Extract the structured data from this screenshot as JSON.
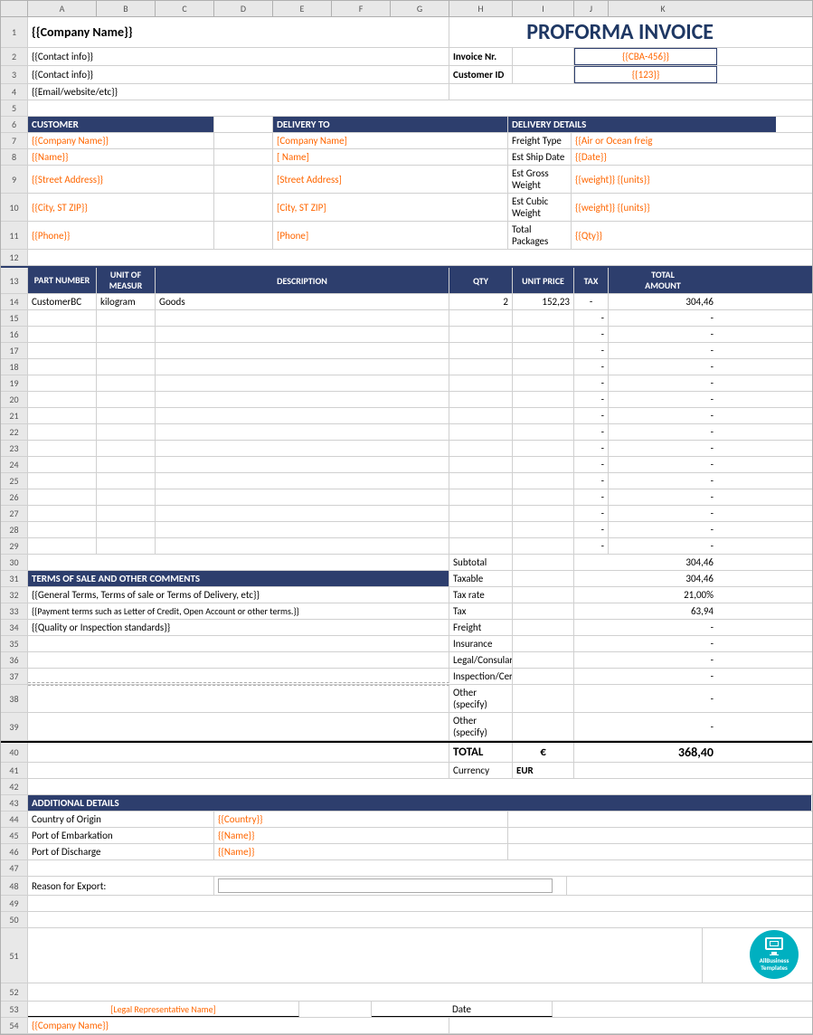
{
  "spreadsheet": {
    "col_headers": [
      "",
      "A",
      "B",
      "C",
      "D",
      "E",
      "F",
      "G",
      "H",
      "I",
      "J",
      "K"
    ],
    "company_name": "{{Company Name}}",
    "contact_info_1": "{{Contact info}}",
    "contact_info_2": "{{Contact info}}",
    "email_website": "{{Email/website/etc}}",
    "title": "PROFORMA INVOICE",
    "invoice_label": "Invoice Nr.",
    "invoice_value": "{{CBA-456}}",
    "customer_id_label": "Customer ID",
    "customer_id_value": "{{123}}",
    "customer_section": {
      "header": "CUSTOMER",
      "company": "{{Company Name}}",
      "name": "{{Name}}",
      "street": "{{Street Address}}",
      "city": "{{City, ST ZIP}}",
      "phone": "{{Phone}}"
    },
    "delivery_to_section": {
      "header": "DELIVERY TO",
      "company": "[Company Name]",
      "name": "[ Name]",
      "street": "[Street Address]",
      "city": "[City, ST  ZIP]",
      "phone": "[Phone]"
    },
    "delivery_details_section": {
      "header": "DELIVERY DETAILS",
      "freight_type_label": "Freight Type",
      "freight_type_value": "{{Air or Ocean freig",
      "ship_date_label": "Est Ship Date",
      "ship_date_value": "{{Date}}",
      "gross_weight_label": "Est Gross Weight",
      "gross_weight_value": "{{weight}} {{units}}",
      "cubic_weight_label": "Est Cubic Weight",
      "cubic_weight_value": "{{weight}} {{units}}",
      "packages_label": "Total Packages",
      "packages_value": "{{Qty}}"
    },
    "table": {
      "headers": [
        "PART NUMBER",
        "UNIT OF MEASUR",
        "DESCRIPTION",
        "QTY",
        "UNIT PRICE",
        "TAX",
        "TOTAL AMOUNT"
      ],
      "rows": [
        {
          "part": "CustomerBC",
          "unit": "kilogram",
          "desc": "Goods",
          "qty": "2",
          "price": "152,23",
          "tax": "-",
          "total": "304,46"
        },
        {
          "part": "",
          "unit": "",
          "desc": "",
          "qty": "",
          "price": "",
          "tax": "-",
          "total": "-"
        },
        {
          "part": "",
          "unit": "",
          "desc": "",
          "qty": "",
          "price": "",
          "tax": "-",
          "total": "-"
        },
        {
          "part": "",
          "unit": "",
          "desc": "",
          "qty": "",
          "price": "",
          "tax": "-",
          "total": "-"
        },
        {
          "part": "",
          "unit": "",
          "desc": "",
          "qty": "",
          "price": "",
          "tax": "-",
          "total": "-"
        },
        {
          "part": "",
          "unit": "",
          "desc": "",
          "qty": "",
          "price": "",
          "tax": "-",
          "total": "-"
        },
        {
          "part": "",
          "unit": "",
          "desc": "",
          "qty": "",
          "price": "",
          "tax": "-",
          "total": "-"
        },
        {
          "part": "",
          "unit": "",
          "desc": "",
          "qty": "",
          "price": "",
          "tax": "-",
          "total": "-"
        },
        {
          "part": "",
          "unit": "",
          "desc": "",
          "qty": "",
          "price": "",
          "tax": "-",
          "total": "-"
        },
        {
          "part": "",
          "unit": "",
          "desc": "",
          "qty": "",
          "price": "",
          "tax": "-",
          "total": "-"
        },
        {
          "part": "",
          "unit": "",
          "desc": "",
          "qty": "",
          "price": "",
          "tax": "-",
          "total": "-"
        },
        {
          "part": "",
          "unit": "",
          "desc": "",
          "qty": "",
          "price": "",
          "tax": "-",
          "total": "-"
        },
        {
          "part": "",
          "unit": "",
          "desc": "",
          "qty": "",
          "price": "",
          "tax": "-",
          "total": "-"
        },
        {
          "part": "",
          "unit": "",
          "desc": "",
          "qty": "",
          "price": "",
          "tax": "-",
          "total": "-"
        },
        {
          "part": "",
          "unit": "",
          "desc": "",
          "qty": "",
          "price": "",
          "tax": "-",
          "total": "-"
        },
        {
          "part": "",
          "unit": "",
          "desc": "",
          "qty": "",
          "price": "",
          "tax": "-",
          "total": "-"
        }
      ]
    },
    "terms_section": {
      "header": "TERMS OF SALE AND OTHER COMMENTS",
      "line1": "{{General Terms, Terms of sale or Terms of Delivery, etc}}",
      "line2": "{{Payment terms such as Letter of Credit, Open Account or other terms.}}",
      "line3": "{{Quality or Inspection standards}}"
    },
    "summary": {
      "subtotal_label": "Subtotal",
      "subtotal_value": "304,46",
      "taxable_label": "Taxable",
      "taxable_value": "304,46",
      "tax_rate_label": "Tax rate",
      "tax_rate_value": "21,00%",
      "tax_label": "Tax",
      "tax_value": "63,94",
      "freight_label": "Freight",
      "freight_value": "-",
      "insurance_label": "Insurance",
      "insurance_value": "-",
      "legal_label": "Legal/Consular",
      "legal_value": "-",
      "inspection_label": "Inspection/Cert.",
      "inspection_value": "-",
      "other1_label": "Other (specify)",
      "other1_value": "-",
      "other2_label": "Other (specify)",
      "other2_value": "-",
      "total_label": "TOTAL",
      "total_currency_symbol": "€",
      "total_value": "368,40",
      "currency_label": "Currency",
      "currency_value": "EUR"
    },
    "additional_details": {
      "header": "ADDITIONAL DETAILS",
      "country_label": "Country of Origin",
      "country_value": "{{Country}}",
      "embarkation_label": "Port of Embarkation",
      "embarkation_value": "{{Name}}",
      "discharge_label": "Port of Discharge",
      "discharge_value": "{{Name}}",
      "reason_label": "Reason for Export:"
    },
    "footer": {
      "sig_label": "[Legal Representative Name]",
      "date_label": "Date",
      "company_footer": "{{Company Name}}",
      "logo_line1": "AllBusiness",
      "logo_line2": "Templates"
    }
  }
}
